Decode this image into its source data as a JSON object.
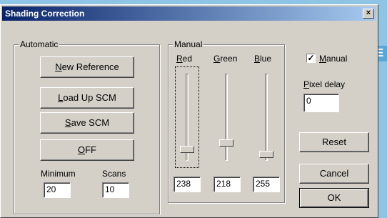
{
  "window": {
    "title": "Shading Correction",
    "close_glyph": "×"
  },
  "automatic": {
    "group_label": "Automatic",
    "buttons": {
      "new_reference": {
        "mnemonic": "N",
        "rest": "ew Reference"
      },
      "load_scm": {
        "pre": "",
        "mnemonic": "L",
        "rest": "oad Up SCM"
      },
      "save_scm": {
        "mnemonic": "S",
        "rest": "ave SCM"
      },
      "off": {
        "mnemonic": "O",
        "rest": "FF"
      }
    },
    "minimum": {
      "label": "Minimum",
      "value": "20"
    },
    "scans": {
      "label": "Scans",
      "value": "10"
    }
  },
  "manual": {
    "group_label": "Manual",
    "channels": [
      {
        "mnemonic": "R",
        "rest": "ed",
        "value": "238",
        "level": 238
      },
      {
        "mnemonic": "G",
        "rest": "reen",
        "value": "218",
        "level": 218
      },
      {
        "mnemonic": "B",
        "rest": "lue",
        "value": "255",
        "level": 255
      }
    ]
  },
  "manual_checkbox": {
    "mnemonic": "M",
    "rest": "anual",
    "checked": true,
    "check_glyph": "✓"
  },
  "pixel_delay": {
    "mnemonic": "P",
    "rest": "ixel delay",
    "value": "0"
  },
  "buttons": {
    "reset": "Reset",
    "cancel": "Cancel",
    "ok": "OK"
  },
  "edge_tab": "E",
  "colors": {
    "title_start": "#0a246a",
    "title_end": "#a6caf0",
    "face": "#d4d0c8",
    "background": "#8ec4e6"
  },
  "icons": {
    "close": "close-icon",
    "check": "check-icon"
  }
}
